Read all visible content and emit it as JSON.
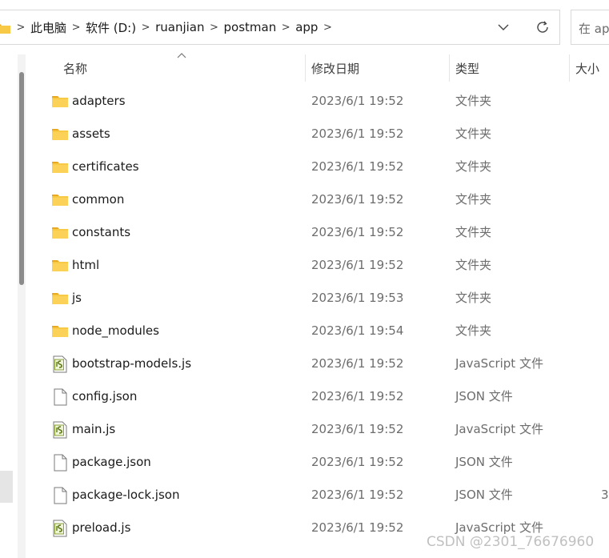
{
  "address_bar": {
    "breadcrumbs": [
      "此电脑",
      "软件 (D:)",
      "ruanjian",
      "postman",
      "app"
    ],
    "separator": ">",
    "dropdown_icon": "chevron-down-icon",
    "refresh_icon": "refresh-icon"
  },
  "search": {
    "placeholder": "在 ap"
  },
  "columns": {
    "name": "名称",
    "date": "修改日期",
    "type": "类型",
    "size": "大小"
  },
  "files": [
    {
      "name": "adapters",
      "date": "2023/6/1 19:52",
      "type": "文件夹",
      "size": "",
      "icon": "folder-icon"
    },
    {
      "name": "assets",
      "date": "2023/6/1 19:52",
      "type": "文件夹",
      "size": "",
      "icon": "folder-icon"
    },
    {
      "name": "certificates",
      "date": "2023/6/1 19:52",
      "type": "文件夹",
      "size": "",
      "icon": "folder-icon"
    },
    {
      "name": "common",
      "date": "2023/6/1 19:52",
      "type": "文件夹",
      "size": "",
      "icon": "folder-icon"
    },
    {
      "name": "constants",
      "date": "2023/6/1 19:52",
      "type": "文件夹",
      "size": "",
      "icon": "folder-icon"
    },
    {
      "name": "html",
      "date": "2023/6/1 19:52",
      "type": "文件夹",
      "size": "",
      "icon": "folder-icon"
    },
    {
      "name": "js",
      "date": "2023/6/1 19:53",
      "type": "文件夹",
      "size": "",
      "icon": "folder-icon"
    },
    {
      "name": "node_modules",
      "date": "2023/6/1 19:54",
      "type": "文件夹",
      "size": "",
      "icon": "folder-icon"
    },
    {
      "name": "bootstrap-models.js",
      "date": "2023/6/1 19:52",
      "type": "JavaScript 文件",
      "size": "",
      "icon": "javascript-file-icon"
    },
    {
      "name": "config.json",
      "date": "2023/6/1 19:52",
      "type": "JSON 文件",
      "size": "",
      "icon": "json-file-icon"
    },
    {
      "name": "main.js",
      "date": "2023/6/1 19:52",
      "type": "JavaScript 文件",
      "size": "",
      "icon": "javascript-file-icon"
    },
    {
      "name": "package.json",
      "date": "2023/6/1 19:52",
      "type": "JSON 文件",
      "size": "",
      "icon": "json-file-icon"
    },
    {
      "name": "package-lock.json",
      "date": "2023/6/1 19:52",
      "type": "JSON 文件",
      "size": "3",
      "icon": "json-file-icon"
    },
    {
      "name": "preload.js",
      "date": "2023/6/1 19:52",
      "type": "JavaScript 文件",
      "size": "",
      "icon": "javascript-file-icon"
    }
  ],
  "watermark": "CSDN @2301_76676960",
  "colors": {
    "folder": "#f8c944",
    "folder_tab": "#e8a920",
    "scrollbar": "#8b8b8b"
  }
}
